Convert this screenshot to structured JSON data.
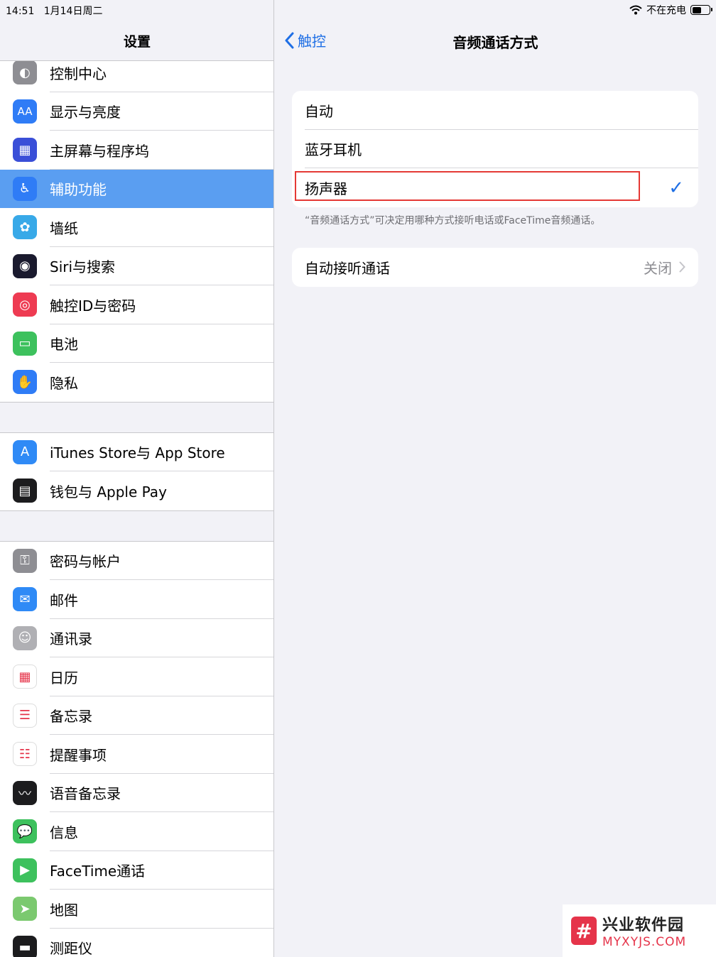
{
  "status": {
    "time": "14:51",
    "date": "1月14日周二",
    "charging": "不在充电"
  },
  "sidebar": {
    "title": "设置",
    "groups": [
      [
        {
          "label": "控制中心",
          "icon": "toggles-icon",
          "color": "#8e8e93"
        },
        {
          "label": "显示与亮度",
          "icon": "aa-icon",
          "color": "#2f7cf6"
        },
        {
          "label": "主屏幕与程序坞",
          "icon": "grid-icon",
          "color": "#3a4fd8"
        },
        {
          "label": "辅助功能",
          "icon": "accessibility-icon",
          "color": "#2f7cf6",
          "selected": true
        },
        {
          "label": "墙纸",
          "icon": "flower-icon",
          "color": "#38a9e8"
        },
        {
          "label": "Siri与搜索",
          "icon": "siri-icon",
          "color": "#1a1a2e"
        },
        {
          "label": "触控ID与密码",
          "icon": "fingerprint-icon",
          "color": "#ee3b52"
        },
        {
          "label": "电池",
          "icon": "battery-icon",
          "color": "#3dc15d"
        },
        {
          "label": "隐私",
          "icon": "hand-icon",
          "color": "#2f7cf6"
        }
      ],
      [
        {
          "label": "iTunes Store与 App Store",
          "icon": "appstore-icon",
          "color": "#2f8af6"
        },
        {
          "label": "钱包与 Apple Pay",
          "icon": "wallet-icon",
          "color": "#1c1c1e"
        }
      ],
      [
        {
          "label": "密码与帐户",
          "icon": "key-icon",
          "color": "#8e8e93"
        },
        {
          "label": "邮件",
          "icon": "mail-icon",
          "color": "#2f8af6"
        },
        {
          "label": "通讯录",
          "icon": "contacts-icon",
          "color": "#b0b0b4"
        },
        {
          "label": "日历",
          "icon": "calendar-icon",
          "color": "#ffffff"
        },
        {
          "label": "备忘录",
          "icon": "notes-icon",
          "color": "#ffffff"
        },
        {
          "label": "提醒事项",
          "icon": "reminders-icon",
          "color": "#ffffff"
        },
        {
          "label": "语音备忘录",
          "icon": "voice-memo-icon",
          "color": "#1c1c1e"
        },
        {
          "label": "信息",
          "icon": "messages-icon",
          "color": "#3dc15d"
        },
        {
          "label": "FaceTime通话",
          "icon": "facetime-icon",
          "color": "#3dc15d"
        },
        {
          "label": "地图",
          "icon": "maps-icon",
          "color": "#7bc96f"
        },
        {
          "label": "测距仪",
          "icon": "measure-icon",
          "color": "#1c1c1e"
        }
      ]
    ]
  },
  "detail": {
    "back_label": "触控",
    "title": "音频通话方式",
    "options": [
      "自动",
      "蓝牙耳机",
      "扬声器"
    ],
    "selected_index": 2,
    "footnote": "“音频通话方式”可决定用哪种方式接听电话或FaceTime音频通话。",
    "auto_answer": {
      "label": "自动接听通话",
      "value": "关闭"
    }
  },
  "watermark": {
    "title": "兴业软件园",
    "subtitle": "MYXYJS.COM"
  }
}
